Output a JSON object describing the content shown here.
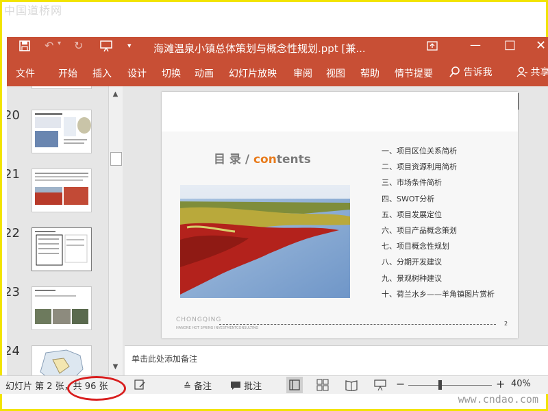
{
  "watermark_top": "中国道桥网",
  "watermark_bottom": "www.cndao.com",
  "titlebar": {
    "title": "海滩温泉小镇总体策划与概念性规划.ppt [兼...",
    "icons": [
      "save-icon",
      "undo-icon",
      "redo-icon",
      "present-icon",
      "customize-icon"
    ]
  },
  "ribbon": {
    "tabs": [
      "文件",
      "开始",
      "插入",
      "设计",
      "切换",
      "动画",
      "幻灯片放映",
      "审阅",
      "视图",
      "帮助",
      "情节提要"
    ],
    "search_label": "告诉我",
    "share_label": "共享"
  },
  "thumbnails": {
    "numbers": [
      "20",
      "21",
      "22",
      "23",
      "24"
    ]
  },
  "slide": {
    "heading_cn": "目  录 / ",
    "heading_en_prefix": "con",
    "heading_en_suffix": "tents",
    "toc": [
      "一、项目区位关系简析",
      "二、项目资源利用简析",
      "三、市场条件简析",
      "四、SWOT分析",
      "五、项目发展定位",
      "六、项目产品概念策划",
      "七、项目概念性规划",
      "八、分期开发建议",
      "九、景观树种建议",
      "十、荷兰水乡——羊角镇图片赏析"
    ],
    "footer_city": "CHONGQING",
    "footer_sub": "HANONE HOT SPRING INVESTMENTCONSULTING",
    "page_number": "2"
  },
  "notes_placeholder": "单击此处添加备注",
  "statusbar": {
    "slide_info": "幻灯片 第 2 张，共 96 张",
    "notes_label": "备注",
    "comments_label": "批注",
    "zoom": "40%",
    "zoom_level": 0.4
  },
  "colors": {
    "ribbon": "#c84f35",
    "accent_orange": "#e87c1e",
    "highlight_circle": "#d81e1e",
    "frame": "#f2e400"
  }
}
